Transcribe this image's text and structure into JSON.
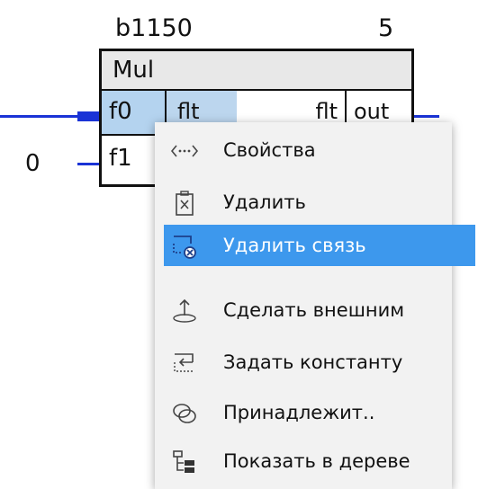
{
  "block": {
    "name": "b1150",
    "order": "5",
    "type": "Mul",
    "inputs": [
      {
        "name": "f0",
        "type": "flt"
      },
      {
        "name": "f1"
      }
    ],
    "output": {
      "type": "flt",
      "name": "out"
    },
    "constant_f1": "0"
  },
  "context_menu": {
    "items": [
      {
        "label": "Свойства",
        "icon": "properties-icon"
      },
      {
        "label": "Удалить",
        "icon": "delete-icon"
      },
      {
        "label": "Удалить связь",
        "icon": "remove-link-icon",
        "highlighted": true
      },
      {
        "label": "Сделать внешним",
        "icon": "make-external-icon"
      },
      {
        "label": "Задать константу",
        "icon": "set-constant-icon"
      },
      {
        "label": "Принадлежит..",
        "icon": "belongs-to-icon"
      },
      {
        "label": "Показать в дереве",
        "icon": "show-in-tree-icon"
      }
    ]
  },
  "colors": {
    "wire": "#1a33d6",
    "highlight": "#3d98ed",
    "port_highlight": "#b4d3ef"
  }
}
